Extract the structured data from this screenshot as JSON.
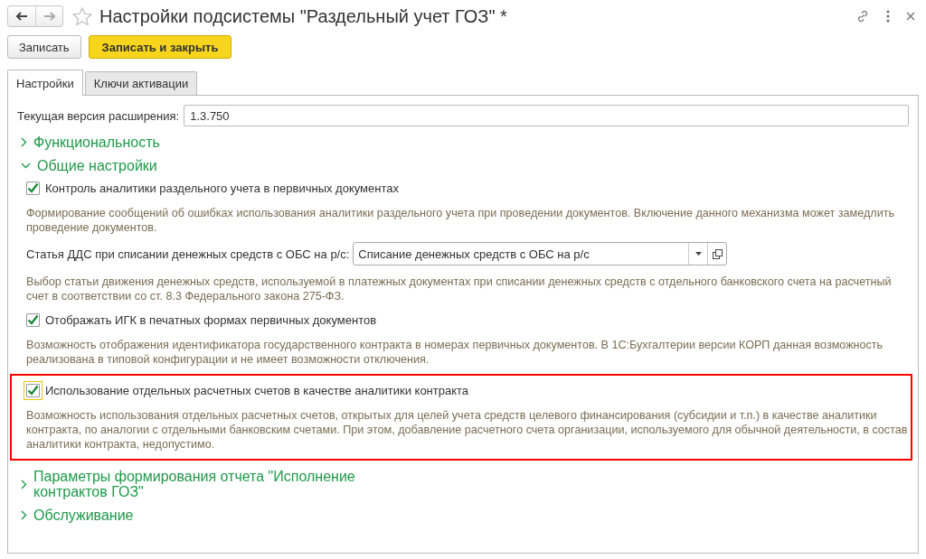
{
  "window": {
    "title": "Настройки подсистемы \"Раздельный учет ГОЗ\" *"
  },
  "nav_buttons": [
    {
      "kind": "back",
      "disabled": false
    },
    {
      "kind": "forward",
      "disabled": true
    }
  ],
  "buttons": [
    {
      "label": "Записать",
      "kind": "default"
    },
    {
      "label": "Записать и закрыть",
      "kind": "primary"
    }
  ],
  "tabs": [
    {
      "label": "Настройки",
      "selected": true
    },
    {
      "label": "Ключи активации",
      "selected": false
    }
  ],
  "version_field": {
    "label": "Текущая версия расширения:",
    "value": "1.3.750"
  },
  "groups": [
    {
      "title": "Функциональность",
      "expanded": false
    },
    {
      "title": "Общие настройки",
      "expanded": true,
      "items": [
        {
          "kind": "checkbox",
          "label": "Контроль аналитики раздельного учета в первичных документах",
          "checked": true,
          "focused": false
        },
        {
          "kind": "note",
          "text": "Формирование сообщений об ошибках использования аналитики раздельного учета при проведении документов. Включение данного механизма может замедлить проведение документов."
        },
        {
          "kind": "select",
          "label": "Статья ДДС при списании денежных средств с ОБС на р/с:",
          "value": "Списание денежных средств с ОБС на р/с"
        },
        {
          "kind": "note",
          "text": "Выбор статьи движения денежных средств, используемой в платежных документах при списании денежных средств с отдельного банковского счета на расчетный счет в соответствии со ст. 8.3 Федерального закона 275-ФЗ."
        },
        {
          "kind": "checkbox",
          "label": "Отображать ИГК в печатных формах первичных документов",
          "checked": true,
          "focused": false
        },
        {
          "kind": "note",
          "text": "Возможность отображения идентификатора государственного контракта в номерах первичных документов. В 1С:Бухгалтерии версии КОРП данная возможность реализована в типовой конфигурации и не имеет возможности отключения."
        },
        {
          "kind": "callout",
          "items": [
            {
              "kind": "checkbox",
              "label": "Использование отдельных расчетных счетов в качестве аналитики контракта",
              "checked": true,
              "focused": true
            },
            {
              "kind": "note",
              "text": "Возможность использования отдельных расчетных счетов, открытых для целей учета средств целевого финансирования (субсидии и т.п.) в качестве аналитики контракта, по аналогии с отдельными банковским счетами. При этом, добавление расчетного счета организации, используемого для обычной деятельности, в состав аналитики контракта, недопустимо."
            }
          ]
        }
      ]
    },
    {
      "title": "Параметры формирования отчета \"Исполнение контрактов ГОЗ\"",
      "expanded": false
    },
    {
      "title": "Обслуживание",
      "expanded": false
    }
  ]
}
